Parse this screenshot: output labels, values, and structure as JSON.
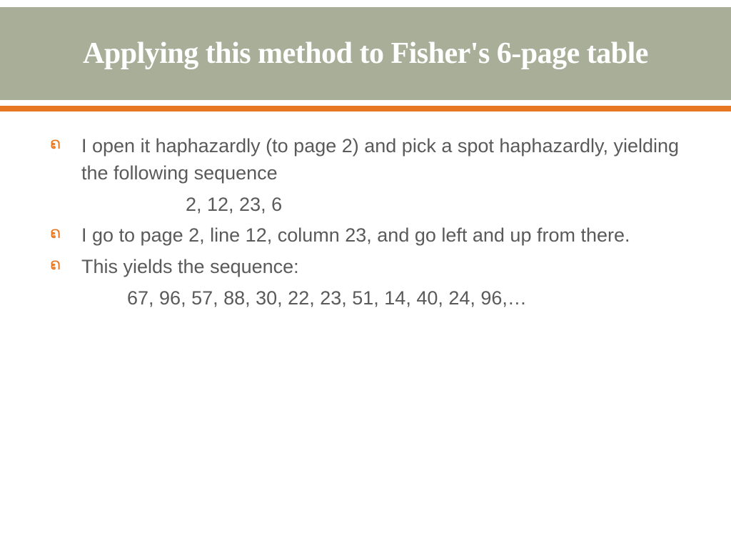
{
  "title": "Applying this method to Fisher's 6-page table",
  "bullets": [
    {
      "text": "I open it haphazardly (to page 2) and pick a spot haphazardly, yielding the following sequence",
      "sub": "2, 12, 23, 6",
      "subStyle": "center"
    },
    {
      "text": "I go to page 2, line 12, column 23, and go left and up from there.",
      "sub": null
    },
    {
      "text": "This yields the sequence:",
      "sub": "67, 96, 57, 88, 30, 22, 23, 51, 14, 40, 24, 96,…",
      "subStyle": "left"
    }
  ],
  "bulletGlyph": "ຄ"
}
